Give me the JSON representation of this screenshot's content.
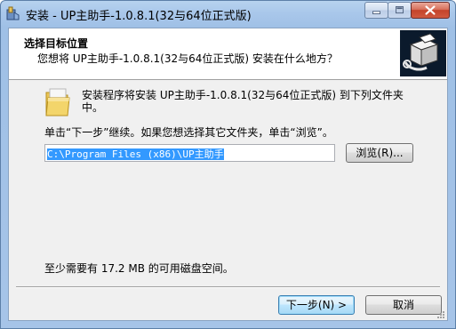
{
  "window": {
    "title": "安装 - UP主助手-1.0.8.1(32与64位正式版)"
  },
  "titlebar": {
    "minimize_icon": "minimize-icon",
    "maximize_icon": "maximize-icon",
    "close_icon": "close-icon"
  },
  "header": {
    "title": "选择目标位置",
    "subtitle": "您想将 UP主助手-1.0.8.1(32与64位正式版) 安装在什么地方？",
    "logo_icon": "installer-box-icon"
  },
  "body": {
    "folder_icon": "folder-icon",
    "intro": "安装程序将安装 UP主助手-1.0.8.1(32与64位正式版) 到下列文件夹中。",
    "instruction": "单击“下一步”继续。如果您想选择其它文件夹，单击“浏览”。",
    "path_value": "C:\\Program Files (x86)\\UP主助手",
    "browse_label": "浏览(R)...",
    "space_required": "至少需要有 17.2 MB 的可用磁盘空间。"
  },
  "footer": {
    "next_label": "下一步(N) >",
    "cancel_label": "取消"
  },
  "colors": {
    "title_bar": "#a9c7ea",
    "client_bg": "#f0f0f0",
    "selection": "#3399ff",
    "close_button": "#c4432a",
    "logo_bg": "#0b1a2c"
  }
}
